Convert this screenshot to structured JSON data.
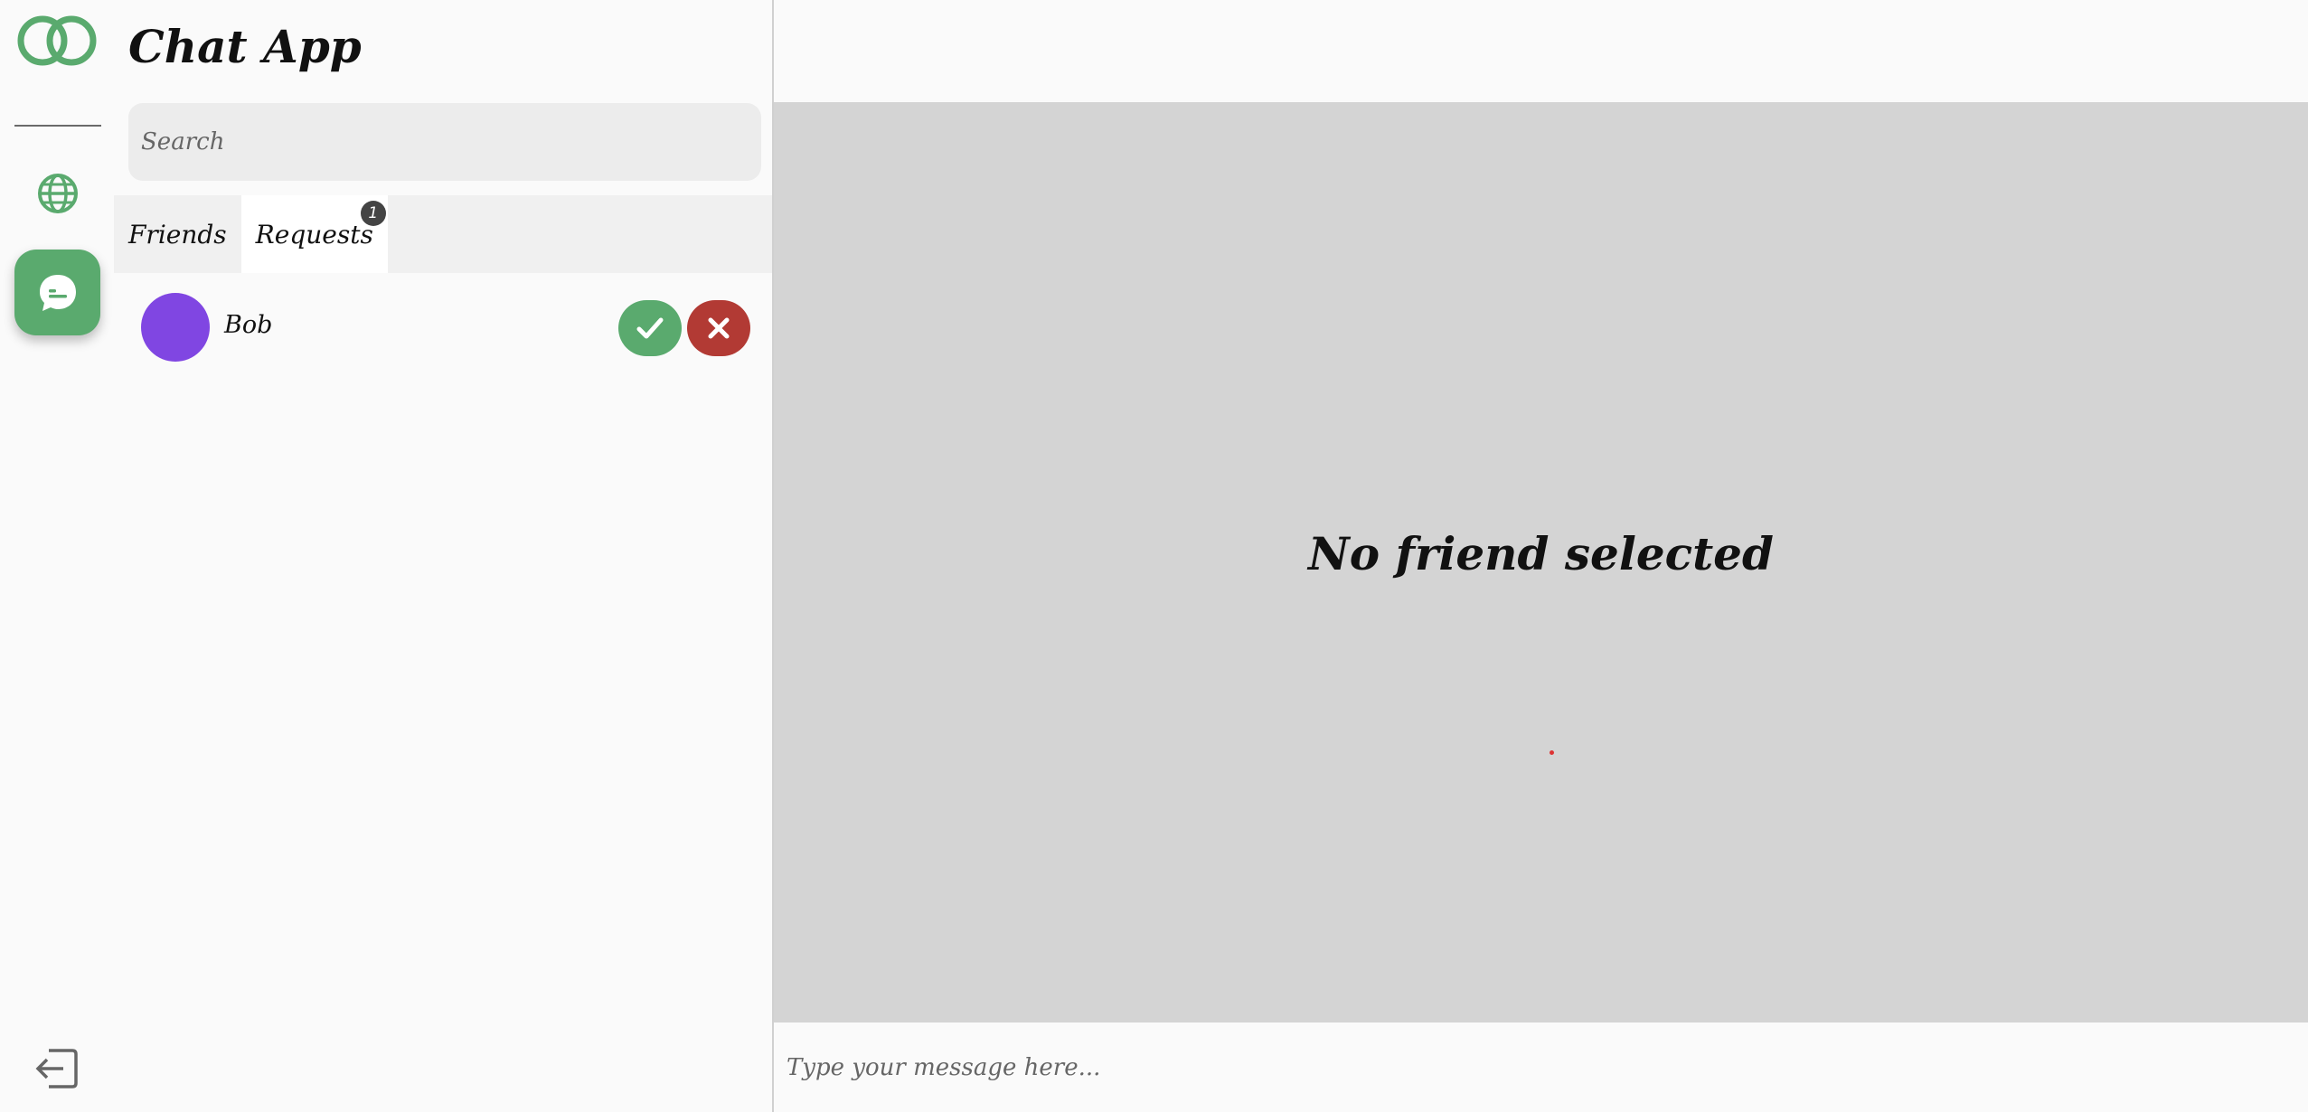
{
  "app": {
    "title": "Chat App"
  },
  "search": {
    "placeholder": "Search",
    "value": ""
  },
  "tabs": [
    {
      "label": "Friends",
      "active": false
    },
    {
      "label": "Requests",
      "active": true,
      "badge": "1"
    }
  ],
  "requests": [
    {
      "name": "Bob",
      "avatar_color": "#8046e2"
    }
  ],
  "chat": {
    "empty_text": "No friend selected",
    "composer_placeholder": "Type your message here..."
  },
  "icons": {
    "logo": "rings-logo-icon",
    "globe": "globe-icon",
    "chat": "chat-bubble-icon",
    "accept": "check-icon",
    "reject": "x-icon",
    "logout": "logout-icon"
  },
  "colors": {
    "brand": "#5aaa6e",
    "accept": "#5aaa6e",
    "reject": "#b23a34",
    "badge": "#444444"
  }
}
